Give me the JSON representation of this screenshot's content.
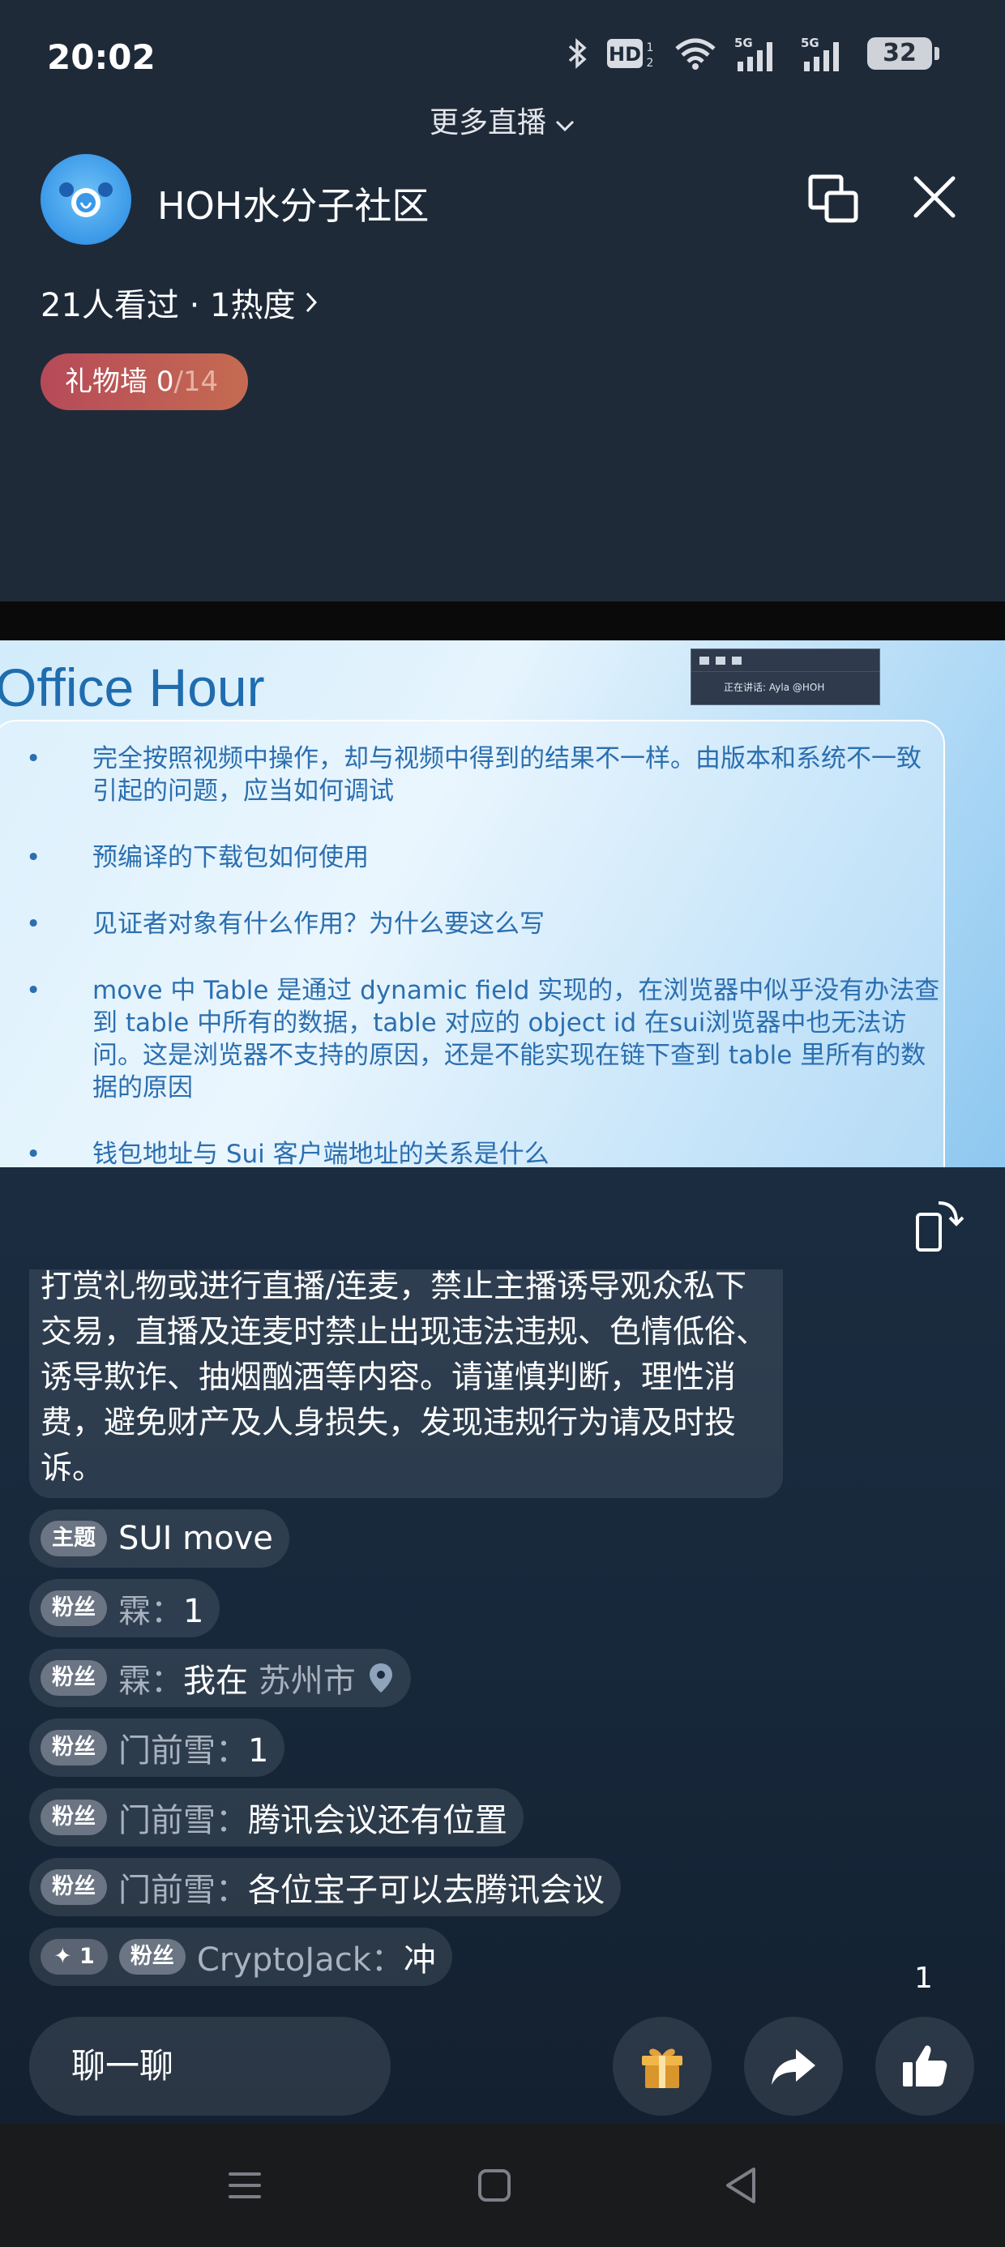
{
  "status_bar": {
    "time": "20:02",
    "battery": "32"
  },
  "header": {
    "more_live_label": "更多直播",
    "room_title": "HOH水分子社区",
    "viewers": "21人看过 · 1热度",
    "gift_wall_label": "礼物墙",
    "gift_wall_count": "0",
    "gift_wall_total": "/14"
  },
  "slide": {
    "title": "Office Hour",
    "mini_window_text": "正在讲话: Ayla @HOH",
    "items": [
      "完全按照视频中操作，却与视频中得到的结果不一样。由版本和系统不一致引起的问题，应当如何调试",
      "预编译的下载包如何使用",
      "见证者对象有什么作用？为什么要这么写",
      "move 中 Table 是通过 dynamic field 实现的，在浏览器中似乎没有办法查到 table 中所有的数据，table 对应的 object id 在sui浏览器中也无法访问。这是浏览器不支持的原因，还是不能实现在链下查到 table 里所有的数据的原因",
      "钱包地址与 Sui 客户端地址的关系是什么"
    ]
  },
  "chat": {
    "notice": "打赏礼物或进行直播/连麦，禁止主播诱导观众私下交易，直播及连麦时禁止出现违法违规、色情低俗、诱导欺诈、抽烟酗酒等内容。请谨慎判断，理性消费，避免财产及人身损失，发现违规行为请及时投诉。",
    "topic": {
      "tag": "主题",
      "text": "SUI move"
    },
    "messages": [
      {
        "tag": "粉丝",
        "user": "霖：",
        "text": "1",
        "location": ""
      },
      {
        "tag": "粉丝",
        "user": "霖：",
        "text": "我在 ",
        "location": "苏州市"
      },
      {
        "tag": "粉丝",
        "user": "门前雪：",
        "text": "1",
        "location": ""
      },
      {
        "tag": "粉丝",
        "user": "门前雪：",
        "text": "腾讯会议还有位置",
        "location": ""
      },
      {
        "tag": "粉丝",
        "user": "门前雪：",
        "text": "各位宝子可以去腾讯会议",
        "location": ""
      },
      {
        "tag": "粉丝",
        "badge": "✦ 1",
        "user": "CryptoJack：",
        "text": "冲",
        "location": ""
      }
    ]
  },
  "bottom": {
    "input_placeholder": "聊一聊",
    "like_count": "1",
    "icons": [
      "gift-icon",
      "share-icon",
      "thumbs-up-icon"
    ]
  },
  "nav": {
    "icons": [
      "menu-icon",
      "home-icon",
      "back-icon"
    ]
  },
  "colors": {
    "gift_wall_start": "#b64a58",
    "gift_wall_end": "#c56b52",
    "slide_text": "#2b6fb0"
  }
}
